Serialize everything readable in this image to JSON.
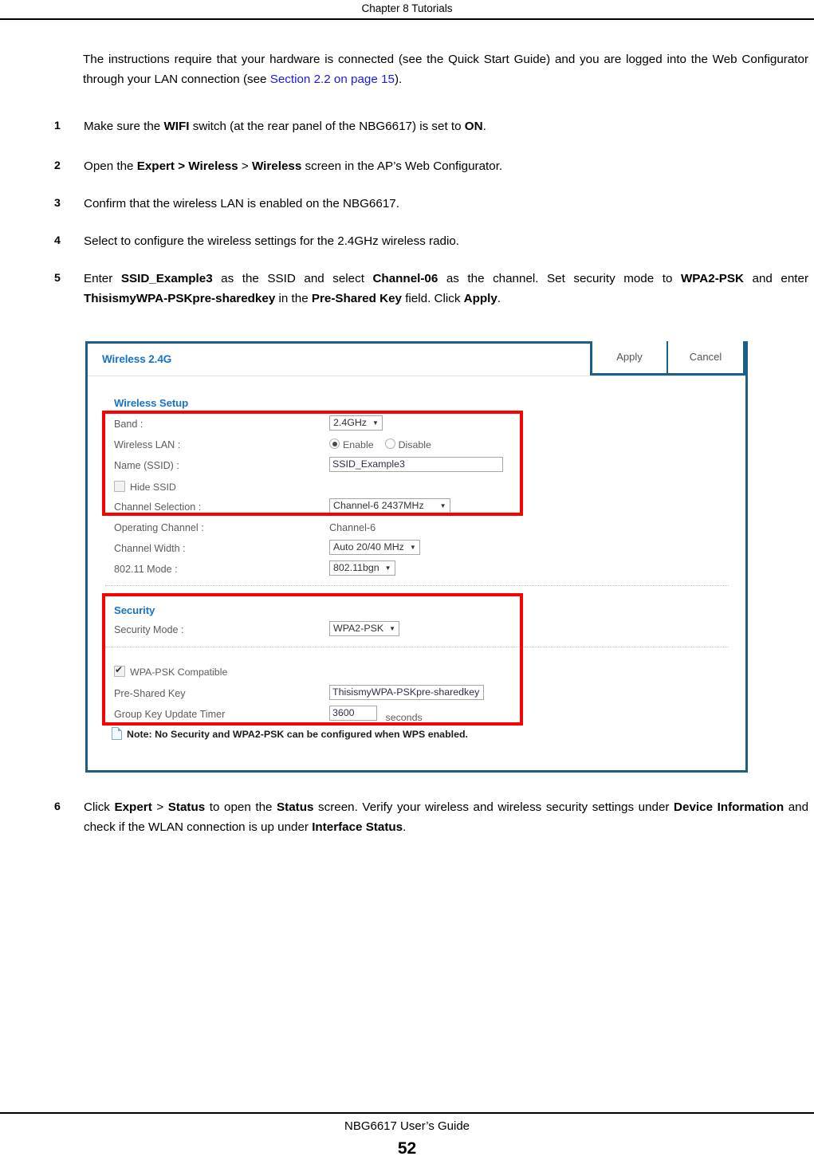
{
  "header": {
    "running_head": "Chapter 8 Tutorials"
  },
  "intro": {
    "text_before_link": "The instructions require that your hardware is connected (see the Quick Start Guide) and you are logged into the Web Configurator through your LAN connection (see ",
    "link_text": "Section 2.2 on page 15",
    "text_after_link": ")."
  },
  "steps": [
    {
      "number": "1",
      "parts": [
        {
          "t": "Make sure the ",
          "b": false
        },
        {
          "t": "WIFI",
          "b": true
        },
        {
          "t": " switch (at the rear panel of the NBG6617) is set to ",
          "b": false
        },
        {
          "t": "ON",
          "b": true
        },
        {
          "t": ".",
          "b": false
        }
      ]
    },
    {
      "number": "2",
      "parts": [
        {
          "t": "Open the ",
          "b": false
        },
        {
          "t": "Expert > Wireless",
          "b": true
        },
        {
          "t": " > ",
          "b": false
        },
        {
          "t": "Wireless",
          "b": true
        },
        {
          "t": " screen in the AP’s Web Configurator.",
          "b": false
        }
      ]
    },
    {
      "number": "3",
      "parts": [
        {
          "t": "Confirm that the wireless LAN is enabled on the NBG6617.",
          "b": false
        }
      ]
    },
    {
      "number": "4",
      "parts": [
        {
          "t": "Select to configure the wireless settings for the 2.4GHz wireless radio.",
          "b": false
        }
      ]
    },
    {
      "number": "5",
      "parts": [
        {
          "t": "Enter ",
          "b": false
        },
        {
          "t": "SSID_Example3",
          "b": true
        },
        {
          "t": " as the SSID and select ",
          "b": false
        },
        {
          "t": "Channel-06",
          "b": true
        },
        {
          "t": " as the channel. Set security mode to ",
          "b": false
        },
        {
          "t": "WPA2-PSK",
          "b": true
        },
        {
          "t": " and enter ",
          "b": false
        },
        {
          "t": "ThisismyWPA-PSKpre-sharedkey",
          "b": true
        },
        {
          "t": " in the ",
          "b": false
        },
        {
          "t": "Pre-Shared Key",
          "b": true
        },
        {
          "t": " field. Click ",
          "b": false
        },
        {
          "t": "Apply",
          "b": true
        },
        {
          "t": ".",
          "b": false
        }
      ]
    },
    {
      "number": "6",
      "parts": [
        {
          "t": "Click ",
          "b": false
        },
        {
          "t": "Expert",
          "b": true
        },
        {
          "t": " > ",
          "b": false
        },
        {
          "t": "Status",
          "b": true
        },
        {
          "t": " to open the ",
          "b": false
        },
        {
          "t": "Status",
          "b": true
        },
        {
          "t": " screen. Verify your wireless and wireless security settings under ",
          "b": false
        },
        {
          "t": "Device Information",
          "b": true
        },
        {
          "t": " and check if the WLAN connection is up under ",
          "b": false
        },
        {
          "t": "Interface Status",
          "b": true
        },
        {
          "t": ".",
          "b": false
        }
      ]
    }
  ],
  "figure": {
    "title": "Wireless 2.4G",
    "apply_label": "Apply",
    "cancel_label": "Cancel",
    "accent_color": "#1573c6",
    "border_color": "#1c5f84",
    "highlight_color": "#fb0000",
    "wireless_setup": {
      "section_title": "Wireless Setup",
      "band": {
        "label": "Band :",
        "value": "2.4GHz"
      },
      "wireless_lan": {
        "label": "Wireless LAN :",
        "enable_label": "Enable",
        "disable_label": "Disable",
        "selected": "Enable"
      },
      "ssid": {
        "label": "Name (SSID) :",
        "value": "SSID_Example3"
      },
      "hide_ssid": {
        "label": "Hide SSID",
        "checked": false
      },
      "channel_selection": {
        "label": "Channel Selection :",
        "value": "Channel-6 2437MHz"
      },
      "operating_channel": {
        "label": "Operating Channel :",
        "value": "Channel-6"
      },
      "channel_width": {
        "label": "Channel Width :",
        "value": "Auto 20/40 MHz"
      },
      "mode_80211": {
        "label": "802.11 Mode :",
        "value": "802.11bgn"
      }
    },
    "security": {
      "section_title": "Security",
      "security_mode": {
        "label": "Security Mode :",
        "value": "WPA2-PSK"
      },
      "wpa_psk_compatible": {
        "label": "WPA-PSK Compatible",
        "checked": true
      },
      "pre_shared_key": {
        "label": "Pre-Shared Key",
        "value": "ThisismyWPA-PSKpre-sharedkey"
      },
      "group_key_update_timer": {
        "label": "Group Key Update Timer",
        "value": "3600",
        "unit": "seconds"
      }
    },
    "note": "Note: No Security and WPA2-PSK can be configured when WPS enabled."
  },
  "footer": {
    "guide": "NBG6617 User’s Guide",
    "page_number": "52"
  }
}
